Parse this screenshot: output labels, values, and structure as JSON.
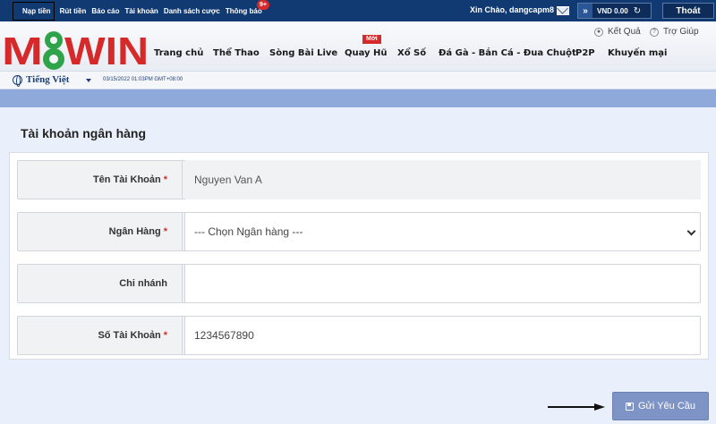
{
  "topbar": {
    "links": [
      "Nạp tiền",
      "Rút tiền",
      "Báo cáo",
      "Tài khoản",
      "Danh sách cược",
      "Thông báo"
    ],
    "notification_badge": "9+",
    "greeting": "Xin Chào, dangcapm8",
    "balance": "VND 0.00",
    "logout_label": "Thoát"
  },
  "header": {
    "logo_text": "M8WIN",
    "nav": [
      "Trang chủ",
      "Thể Thao",
      "Sòng Bài Live",
      "Quay Hũ",
      "Xổ Số",
      "Đá Gà - Bắn Cá - Đua Chuột",
      "P2P",
      "Khuyến mại"
    ],
    "new_badge": "Mới",
    "results_label": "Kết Quả",
    "help_label": "Trợ Giúp"
  },
  "langbar": {
    "language": "Tiếng Việt",
    "datetime": "03/15/2022 01:03PM GMT+08:00"
  },
  "form": {
    "title": "Tài khoản ngân hàng",
    "required_mark": "*",
    "fields": [
      {
        "label": "Tên Tài Khoản",
        "value": "Nguyen Van A",
        "required": true
      },
      {
        "label": "Ngân Hàng",
        "value": "--- Chọn Ngân hàng ---",
        "required": true
      },
      {
        "label": "Chi nhánh",
        "value": "",
        "required": false
      },
      {
        "label": "Số Tài Khoản",
        "value": "1234567890",
        "required": true
      }
    ],
    "submit_label": "Gửi Yêu Cầu"
  },
  "colors": {
    "topbar": "#123a72",
    "band": "#8fa9db",
    "panel": "#eaf0fb",
    "submit": "#7e93c6",
    "accent_red": "#d62a2a"
  }
}
